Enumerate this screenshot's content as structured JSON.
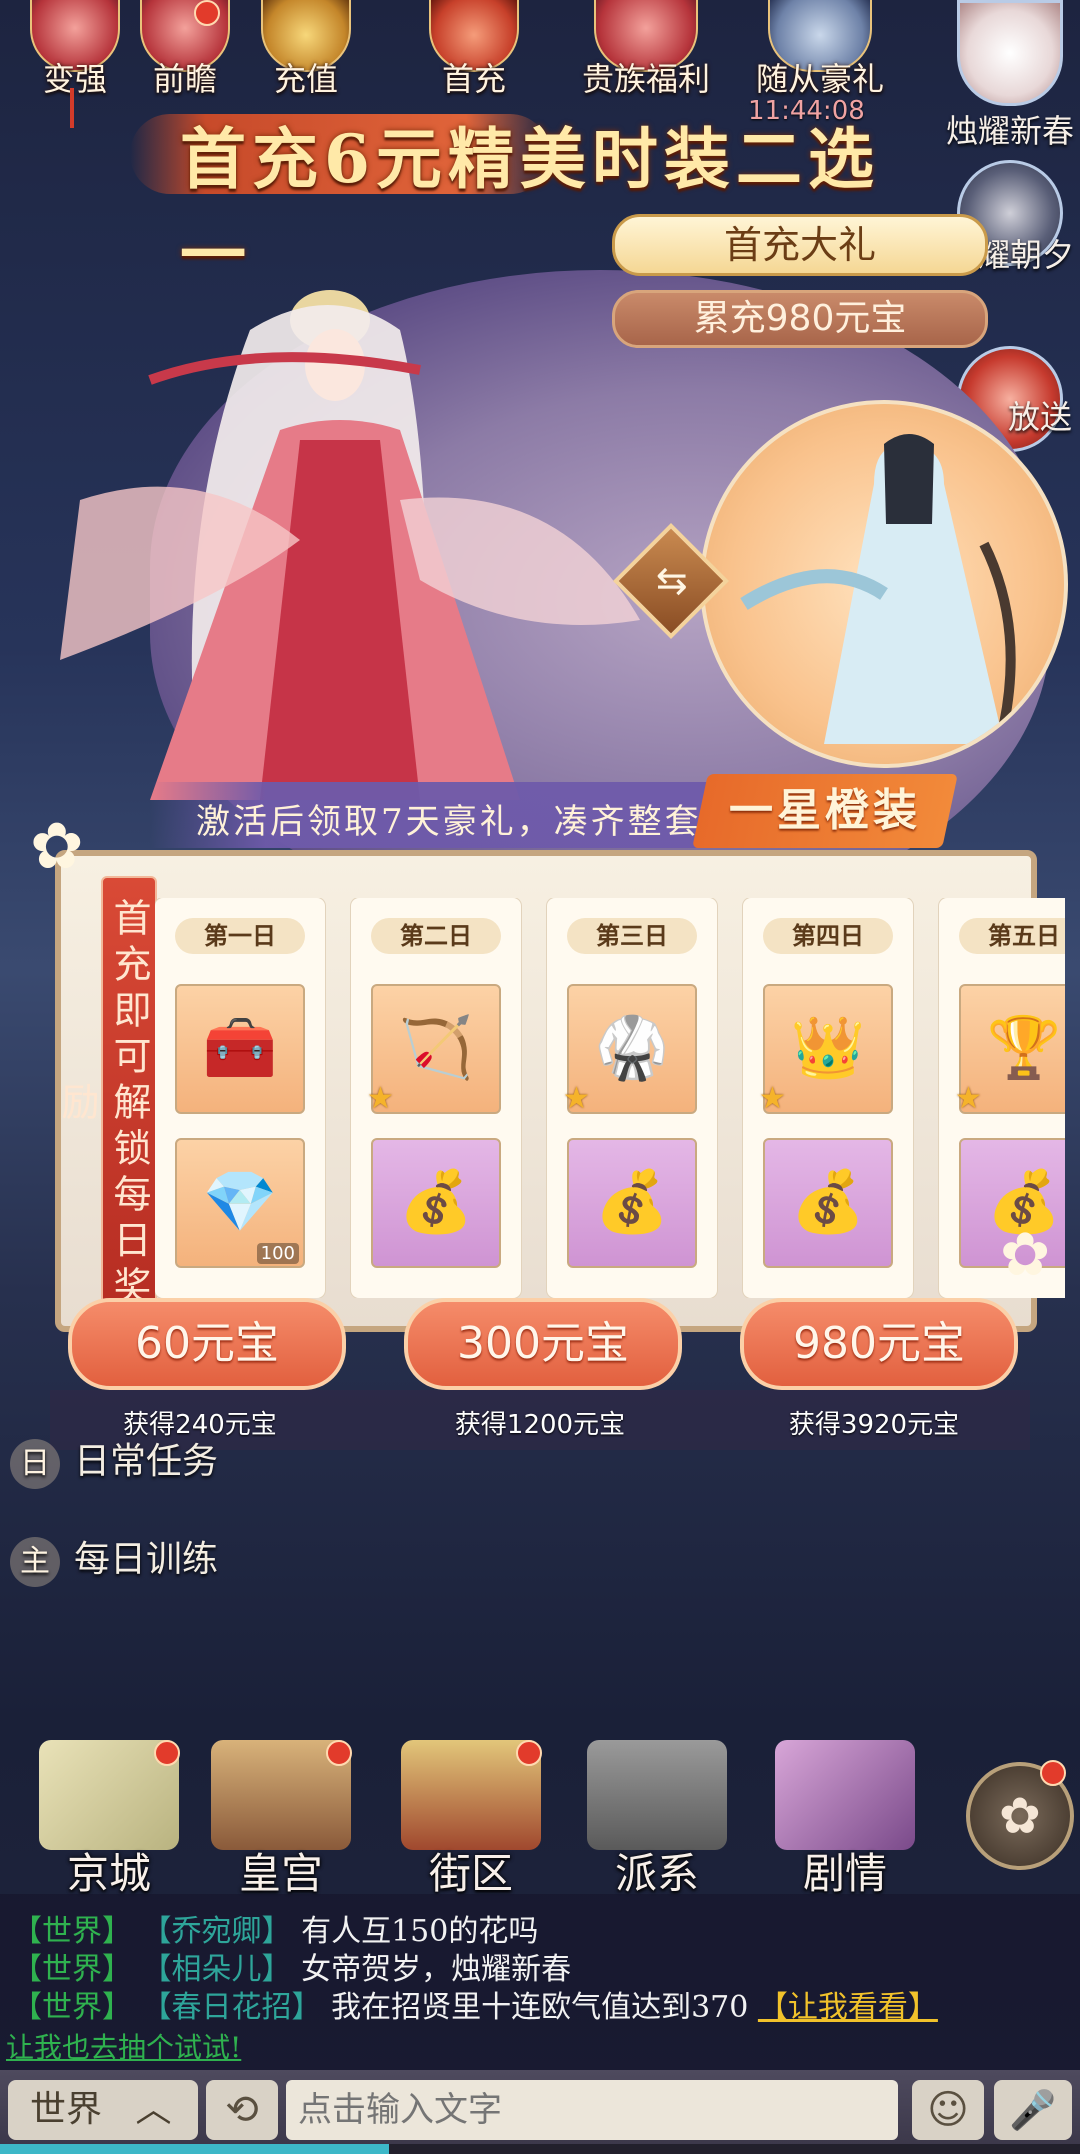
{
  "top_icons": [
    {
      "label": "变强",
      "icon": "strength-icon"
    },
    {
      "label": "前瞻",
      "icon": "preview-icon"
    },
    {
      "label": "充值",
      "icon": "recharge-icon"
    },
    {
      "label": "首充",
      "icon": "first-recharge-icon"
    },
    {
      "label": "贵族福利",
      "icon": "noble-welfare-icon"
    },
    {
      "label": "随从豪礼",
      "icon": "follower-gift-icon"
    }
  ],
  "timer": "11:44:08",
  "right_icons": [
    {
      "label": "烛耀新春",
      "icon": "snowman-icon"
    },
    {
      "label": "烛耀朝夕",
      "icon": "yin-yang-icon"
    },
    {
      "label": "放送",
      "icon": "gift-icon"
    }
  ],
  "banner": {
    "title": "首充6元精美时装二选一"
  },
  "popup": {
    "gift_tab": "首充大礼",
    "total_tab": "累充980元宝",
    "swap_icon": "swap-icon",
    "activate_text": "激活后领取7天豪礼，凑齐整套",
    "activate_highlight": "一星橙装",
    "vertical_banner": "首充即可解锁每日奖励",
    "days": [
      {
        "label": "第一日",
        "item1": "treasure-chest-icon",
        "item2": "purple-gem-icon",
        "item2_count": "100",
        "item2_bg": "org",
        "star": false
      },
      {
        "label": "第二日",
        "item1": "bow-icon",
        "item2": "money-bag-icon",
        "item2_bg": "pink",
        "star": true
      },
      {
        "label": "第三日",
        "item1": "golden-armor-icon",
        "item2": "money-bag-scroll-icon",
        "item2_bg": "pink",
        "star": true
      },
      {
        "label": "第四日",
        "item1": "golden-crown-icon",
        "item2": "money-bag-icon",
        "item2_bg": "pink",
        "star": true
      },
      {
        "label": "第五日",
        "item1": "golden-item-icon",
        "item2": "money-bag-scroll-icon",
        "item2_bg": "pink",
        "star": true
      }
    ],
    "prices": [
      {
        "label": "60元宝",
        "gain": "获得240元宝"
      },
      {
        "label": "300元宝",
        "gain": "获得1200元宝"
      },
      {
        "label": "980元宝",
        "gain": "获得3920元宝"
      }
    ]
  },
  "tasks": [
    {
      "key": "日",
      "label": "日常任务"
    },
    {
      "key": "主",
      "label": "每日训练"
    }
  ],
  "nav": [
    {
      "label": "京城",
      "icon": "map-icon"
    },
    {
      "label": "皇宫",
      "icon": "palace-icon"
    },
    {
      "label": "街区",
      "icon": "street-icon"
    },
    {
      "label": "派系",
      "icon": "faction-icon"
    },
    {
      "label": "剧情",
      "icon": "story-icon"
    },
    {
      "label": "",
      "icon": "flower-menu-icon"
    }
  ],
  "chat": {
    "lines": [
      {
        "channel": "【世界】",
        "name": "【乔宛卿】",
        "msg": "有人互150的花吗"
      },
      {
        "channel": "【世界】",
        "name": "【相朵儿】",
        "msg": "女帝贺岁，烛耀新春"
      },
      {
        "channel": "【世界】",
        "name": "【春日花招】",
        "msg": "我在招贤里十连欧气值达到370",
        "cta": "【让我看看】"
      }
    ],
    "overflow": "让我也去抽个试试!"
  },
  "input": {
    "channel": "世界",
    "placeholder": "点击输入文字"
  },
  "progress": 0.36
}
